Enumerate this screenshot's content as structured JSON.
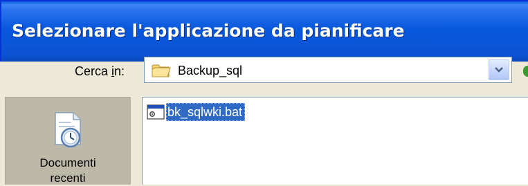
{
  "window": {
    "title": "Selezionare l'applicazione da pianificare"
  },
  "lookin": {
    "label_pre": "Cerca ",
    "label_accel": "i",
    "label_post": "n:",
    "folder_name": "Backup_sql",
    "folder_icon": "folder-icon",
    "dropdown_icon": "chevron-down-icon"
  },
  "places": {
    "items": [
      {
        "label_line1": "Documenti",
        "label_line2": "recenti",
        "icon": "recent-documents-icon"
      }
    ]
  },
  "files": [
    {
      "name": "bk_sqlwki.bat",
      "icon": "batch-file-icon",
      "selected": true
    }
  ],
  "colors": {
    "title_bar": "#0857dc",
    "dialog_bg": "#ece9d8",
    "selection": "#316ac5"
  }
}
